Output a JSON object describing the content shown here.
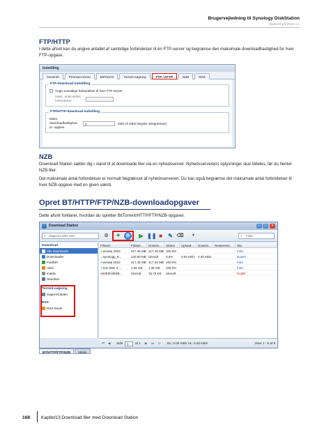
{
  "header": {
    "title": "Brugervejledning til Synology DiskStation",
    "subtitle": "Baseret på DSM 3.1"
  },
  "ftp_section": {
    "heading": "FTP/HTTP",
    "text": "I dette afsnit kan du angive antallet af samtidige forbindelser til én FTP-server og begrænse den maksimale downloadhastighed for hver FTP-opgave."
  },
  "settings_window": {
    "title": "Indstilling",
    "tabs": [
      "Generelt",
      "Premium-konto",
      "BitTorrent",
      "Torrent-søgning",
      "FTP / HTTP",
      "NZB",
      "RSS"
    ],
    "active_tab": 4,
    "group1_legend": "FTP-download-indstilling",
    "group1_checkbox": "Angiv samtidige forbindelser til hver FTP-server",
    "group1_field_label": "Maks. antal aktive forbindelser",
    "group2_legend": "FTP/HTTP-download-indstilling",
    "group2_field_label": "Maks. downloadhastighed pr. opgave",
    "group2_field_value": "0",
    "group2_field_suffix": "KB/s (0 KB/s betyder ubegrænset)."
  },
  "nzb_section": {
    "heading": "NZB",
    "text1": "Download Station sætter dig i stand til at downloade filer via en nyhedsserver. Nyhedsserverens oplysninger skal tildeles, før du henter NZB-filer.",
    "text2": "Det maksimale antal forbindelser er normalt begrænset af nyhedsserveren. Du kan også begrænse det maksimale antal forbindelser til hver NZB-opgave med en given værdi."
  },
  "create_section": {
    "heading": "Opret BT/HTTP/FTP/NZB-downloadopgaver",
    "text": "Dette afsnit forklarer, hvordan du opretter BitTorrent/HTTP/FTP/NZB-opgaver."
  },
  "download_station": {
    "title": "Download Station",
    "search_placeholder": "Søgeord eller URL",
    "filter_placeholder": "Filter",
    "sidebar": {
      "download_section": "Download",
      "items": [
        "Alle downloads",
        "Downloader",
        "Fuldført",
        "Aktiv",
        "Inaktiv",
        "Standset"
      ],
      "torrent_section": "Torrent-søgning",
      "torrent_items": [
        "Søgeresultater"
      ],
      "rss_section": "RSS",
      "rss_items": [
        "RSS-feeds"
      ]
    },
    "columns": [
      "Filnavn",
      "Filstørr...",
      "Downlo...",
      "Status",
      "Upload-...",
      "Downlo...",
      "Resterend...",
      "Sta"
    ],
    "rows": [
      [
        "avnata 2010",
        "417.45 MB",
        "417.45 MB",
        "100.0%",
        "",
        "",
        "",
        "Fuld"
      ],
      [
        "synology_8...",
        "120.50 MB",
        "Ukendt",
        "0.0%",
        "0.00 KB/s",
        "0.00 KB/s",
        "",
        "Downl"
      ],
      [
        "avnata 2010",
        "417.45 MB",
        "417.45 MB",
        "100.0%",
        "",
        "",
        "",
        "Fuld"
      ],
      [
        "Iron Man 2 ...",
        "1.35 GB",
        "1.35 GB",
        "100.0%",
        "",
        "",
        "",
        "Fuld"
      ],
      [
        "62E0C0E8B...",
        "Ukendt",
        "16.76 KB",
        "Ukendt",
        "",
        "",
        "",
        "Duplik"
      ]
    ],
    "pager": {
      "page_label": "Side",
      "page_value": "1",
      "of_label": "af 1",
      "speeds": "DL: 0.00 KB/s  UL: 0.00 KB/s",
      "display": "Viser 1 - 5 af 5"
    },
    "bottom_tabs": [
      "BT/HTTP/FTP/NZB",
      "eMule"
    ]
  },
  "footer": {
    "page_number": "168",
    "chapter": "Kapitel13:Download filer med Download Station"
  },
  "colors": {
    "heading": "#1e3a78",
    "highlight": "#e01010",
    "selected": "#3b74c3"
  }
}
